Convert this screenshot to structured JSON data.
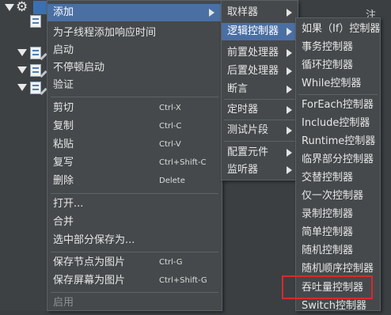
{
  "background": {
    "note_fragment": "注释："
  },
  "menu1": {
    "items": [
      {
        "label": "添加"
      },
      {
        "label": "为子线程添加响应时间"
      },
      {
        "label": "启动"
      },
      {
        "label": "不停顿启动"
      },
      {
        "label": "验证"
      },
      {
        "label": "剪切",
        "shortcut": "Ctrl-X"
      },
      {
        "label": "复制",
        "shortcut": "Ctrl-C"
      },
      {
        "label": "粘贴",
        "shortcut": "Ctrl-V"
      },
      {
        "label": "复写",
        "shortcut": "Ctrl+Shift-C"
      },
      {
        "label": "删除",
        "shortcut": "Delete"
      },
      {
        "label": "打开..."
      },
      {
        "label": "合并"
      },
      {
        "label": "选中部分保存为..."
      },
      {
        "label": "保存节点为图片",
        "shortcut": "Ctrl-G"
      },
      {
        "label": "保存屏幕为图片",
        "shortcut": "Ctrl+Shift-G"
      },
      {
        "label": "启用"
      }
    ]
  },
  "menu2": {
    "items": [
      {
        "label": "取样器"
      },
      {
        "label": "逻辑控制器"
      },
      {
        "label": "前置处理器"
      },
      {
        "label": "后置处理器"
      },
      {
        "label": "断言"
      },
      {
        "label": "定时器"
      },
      {
        "label": "测试片段"
      },
      {
        "label": "配置元件"
      },
      {
        "label": "监听器"
      }
    ]
  },
  "menu3": {
    "items": [
      {
        "label": "如果（If）控制器"
      },
      {
        "label": "事务控制器"
      },
      {
        "label": "循环控制器"
      },
      {
        "label": "While控制器"
      },
      {
        "label": "ForEach控制器"
      },
      {
        "label": "Include控制器"
      },
      {
        "label": "Runtime控制器"
      },
      {
        "label": "临界部分控制器"
      },
      {
        "label": "交替控制器"
      },
      {
        "label": "仅一次控制器"
      },
      {
        "label": "录制控制器"
      },
      {
        "label": "简单控制器"
      },
      {
        "label": "随机控制器"
      },
      {
        "label": "随机顺序控制器"
      },
      {
        "label": "吞吐量控制器"
      },
      {
        "label": "Switch控制器"
      }
    ],
    "highlighted_item": "吞吐量控制器"
  },
  "colors": {
    "menu_bg": "#45494b",
    "selection": "#4a6fa3",
    "highlight_box": "#d62b2b"
  }
}
